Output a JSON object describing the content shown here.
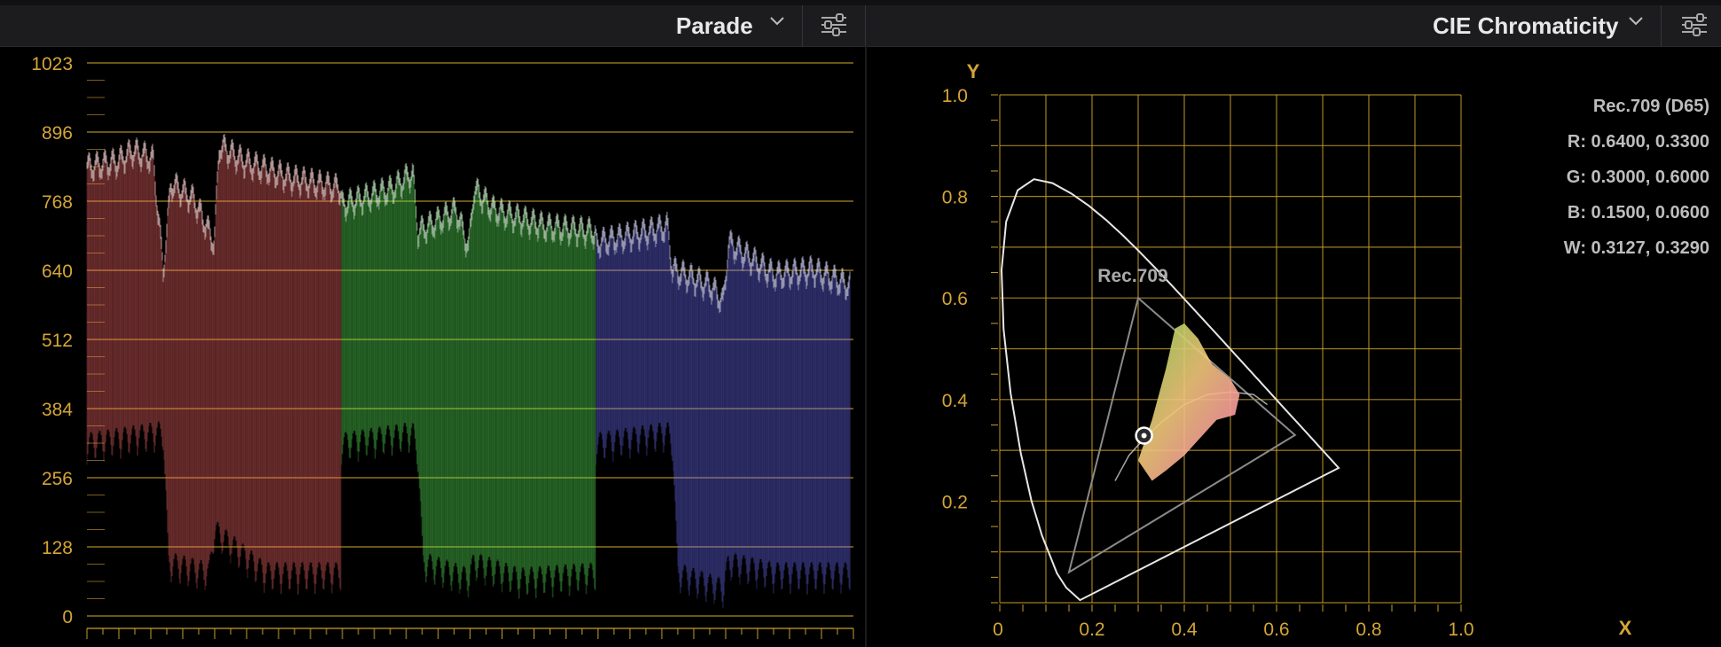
{
  "left_panel": {
    "title": "Parade",
    "y_ticks": [
      "1023",
      "896",
      "768",
      "640",
      "512",
      "384",
      "256",
      "128",
      "0"
    ]
  },
  "right_panel": {
    "title": "CIE Chromaticity",
    "y_axis_label": "Y",
    "x_axis_label": "X",
    "y_ticks": [
      "1.0",
      "0.8",
      "0.6",
      "0.4",
      "0.2"
    ],
    "x_ticks": [
      "0",
      "0.2",
      "0.4",
      "0.6",
      "0.8",
      "1.0"
    ],
    "gamut_label": "Rec.709",
    "info": {
      "heading": "Rec.709 (D65)",
      "lines": [
        "R: 0.6400, 0.3300",
        "G: 0.3000, 0.6000",
        "B: 0.1500, 0.0600",
        "W: 0.3127, 0.3290"
      ]
    }
  },
  "colors": {
    "grid": "#c8a12a",
    "label": "#d4a537",
    "red": "#ff6b6b",
    "green": "#5cf25c",
    "blue": "#6f6fff",
    "curve": "#e6e6e6"
  },
  "icons": {
    "dropdown": "chevron-down-icon",
    "settings": "sliders-icon"
  }
}
